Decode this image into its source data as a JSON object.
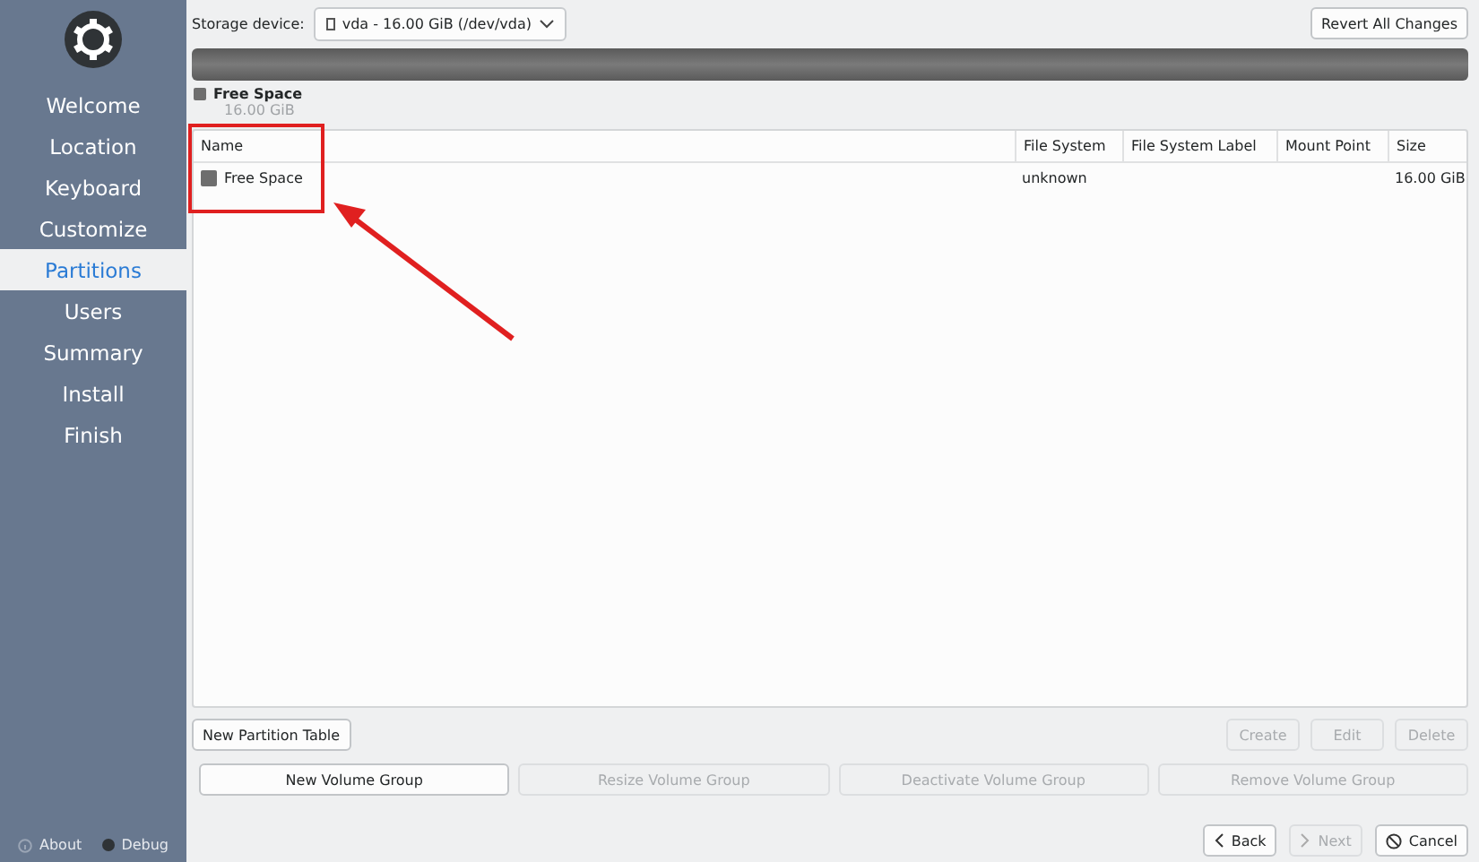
{
  "sidebar": {
    "items": [
      {
        "label": "Welcome",
        "selected": false
      },
      {
        "label": "Location",
        "selected": false
      },
      {
        "label": "Keyboard",
        "selected": false
      },
      {
        "label": "Customize",
        "selected": false
      },
      {
        "label": "Partitions",
        "selected": true
      },
      {
        "label": "Users",
        "selected": false
      },
      {
        "label": "Summary",
        "selected": false
      },
      {
        "label": "Install",
        "selected": false
      },
      {
        "label": "Finish",
        "selected": false
      }
    ],
    "footer": [
      {
        "label": "About",
        "kind": "info"
      },
      {
        "label": "Debug",
        "kind": "dot"
      }
    ]
  },
  "storage": {
    "label": "Storage device:",
    "device": "vda - 16.00 GiB (/dev/vda)"
  },
  "revert_button": {
    "label": "Revert All Changes",
    "disabled": false
  },
  "legend": {
    "name": "Free Space",
    "size": "16.00 GiB",
    "color": "#6e6e6e"
  },
  "table": {
    "columns": [
      "Name",
      "File System",
      "File System Label",
      "Mount Point",
      "Size"
    ],
    "rows": [
      {
        "name": "Free Space",
        "color": "#6e6e6e",
        "file_system": "unknown",
        "label": "",
        "mount_point": "",
        "size": "16.00 GiB"
      }
    ]
  },
  "partition_buttons": [
    {
      "label": "New Partition Table",
      "disabled": false
    },
    {
      "label": "Create",
      "disabled": true
    },
    {
      "label": "Edit",
      "disabled": true
    },
    {
      "label": "Delete",
      "disabled": true
    }
  ],
  "volume_buttons": [
    {
      "label": "New Volume Group",
      "disabled": false
    },
    {
      "label": "Resize Volume Group",
      "disabled": true
    },
    {
      "label": "Deactivate Volume Group",
      "disabled": true
    },
    {
      "label": "Remove Volume Group",
      "disabled": true
    }
  ],
  "nav_buttons": [
    {
      "label": "Back",
      "kind": "back",
      "disabled": false
    },
    {
      "label": "Next",
      "kind": "next",
      "disabled": true
    },
    {
      "label": "Cancel",
      "kind": "cancel",
      "disabled": false
    }
  ]
}
